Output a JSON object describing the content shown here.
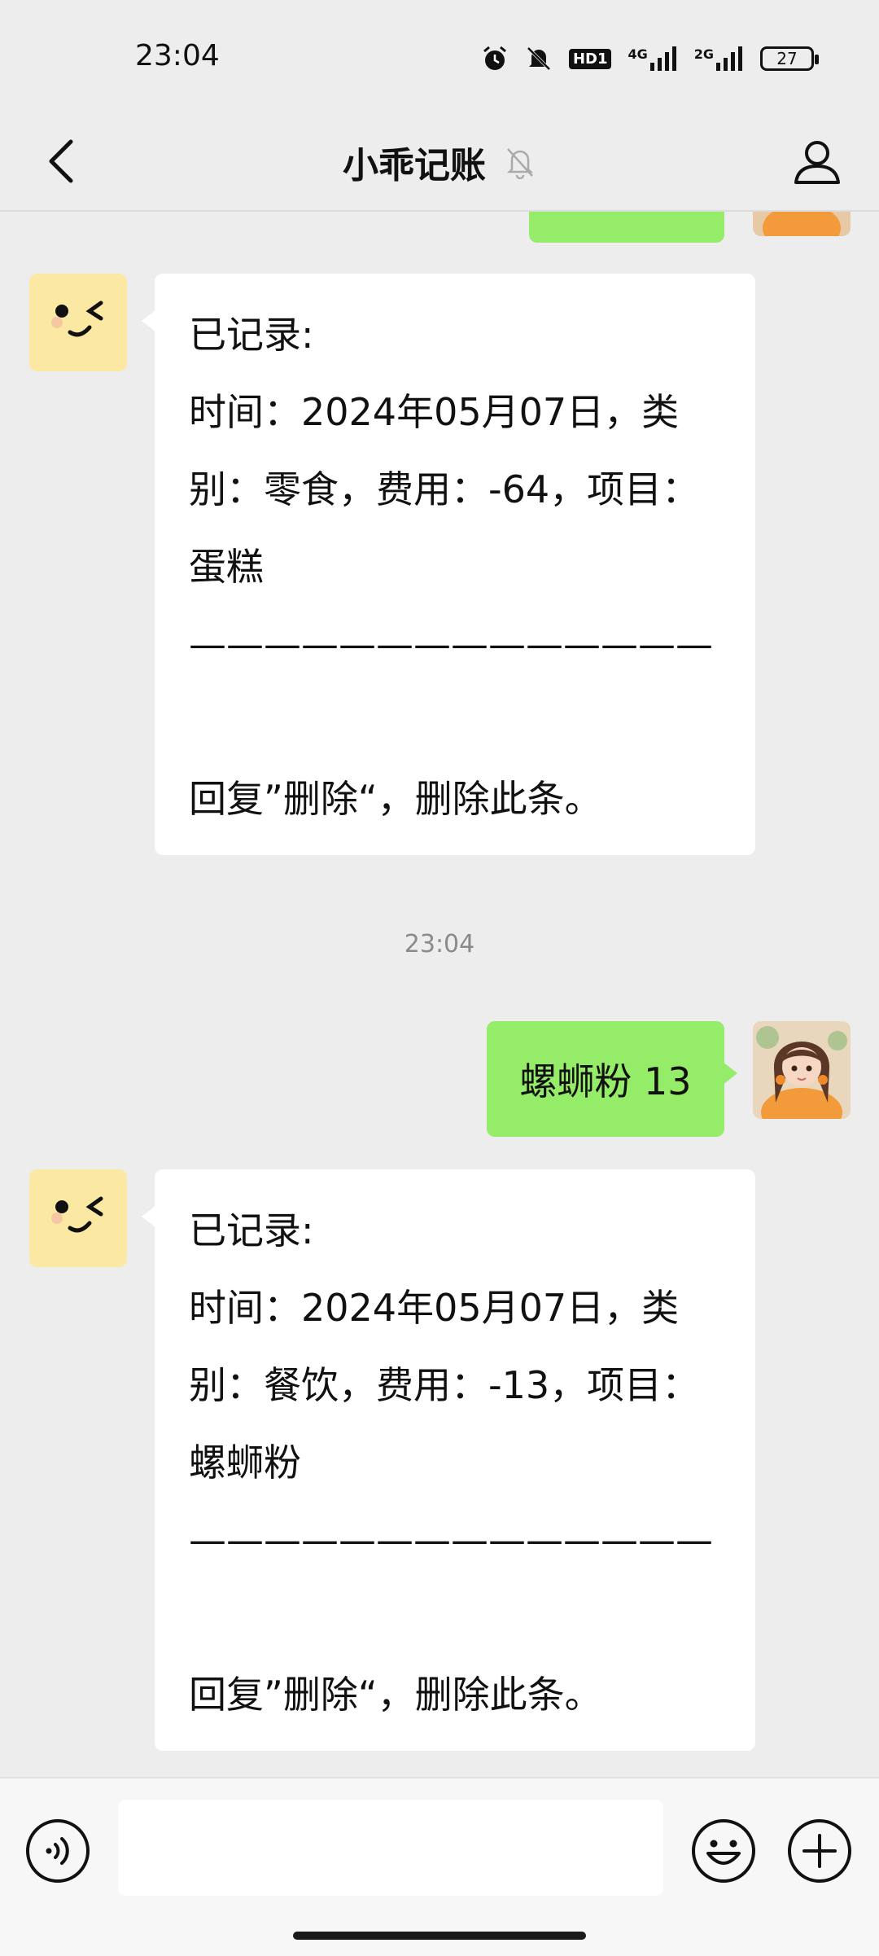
{
  "status_bar": {
    "time": "23:04",
    "network_1": "4G",
    "network_2": "2G",
    "hd_label": "HD1",
    "battery": "27"
  },
  "header": {
    "title": "小乖记账"
  },
  "messages": {
    "bot_1": "已记录:\n时间：2024年05月07日，类别：零食，费用：-64，项目：蛋糕\n——————————————\n\n回复”删除“，删除此条。",
    "timestamp": "23:04",
    "user_1": "螺蛳粉 13",
    "bot_2": "已记录:\n时间：2024年05月07日，类别：餐饮，费用：-13，项目：螺蛳粉\n——————————————\n\n回复”删除“，删除此条。"
  },
  "icons": {
    "back": "chevron-left-icon",
    "muted": "bell-off-icon",
    "profile": "person-icon",
    "voice": "voice-icon",
    "emoji": "smile-icon",
    "plus": "plus-icon"
  },
  "colors": {
    "sent_bubble": "#95ec69",
    "received_bubble": "#ffffff",
    "background": "#ededed"
  }
}
